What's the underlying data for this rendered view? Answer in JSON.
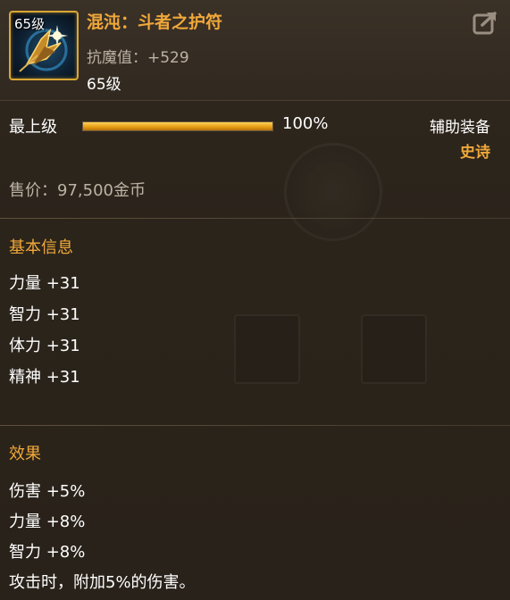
{
  "item": {
    "icon_level": "65级",
    "name": "混沌：斗者之护符",
    "resist": "抗魔值：+529",
    "level": "65级",
    "icon_name": "amulet-icon"
  },
  "grade": {
    "label": "最上级",
    "progress": 1.0,
    "progress_text": "100%",
    "equip_type": "辅助装备",
    "rarity": "史诗"
  },
  "price": "售价：97,500金币",
  "basic_info": {
    "title": "基本信息",
    "stats": [
      "力量 +31",
      "智力 +31",
      "体力 +31",
      "精神 +31"
    ]
  },
  "effects": {
    "title": "效果",
    "stats": [
      "伤害 +5%",
      "力量 +8%",
      "智力 +8%",
      "攻击时，附加5%的伤害。"
    ]
  },
  "colors": {
    "accent": "#f0a83a",
    "border": "#d9a735",
    "muted": "#bdb2a3",
    "background": "#2b241b"
  }
}
